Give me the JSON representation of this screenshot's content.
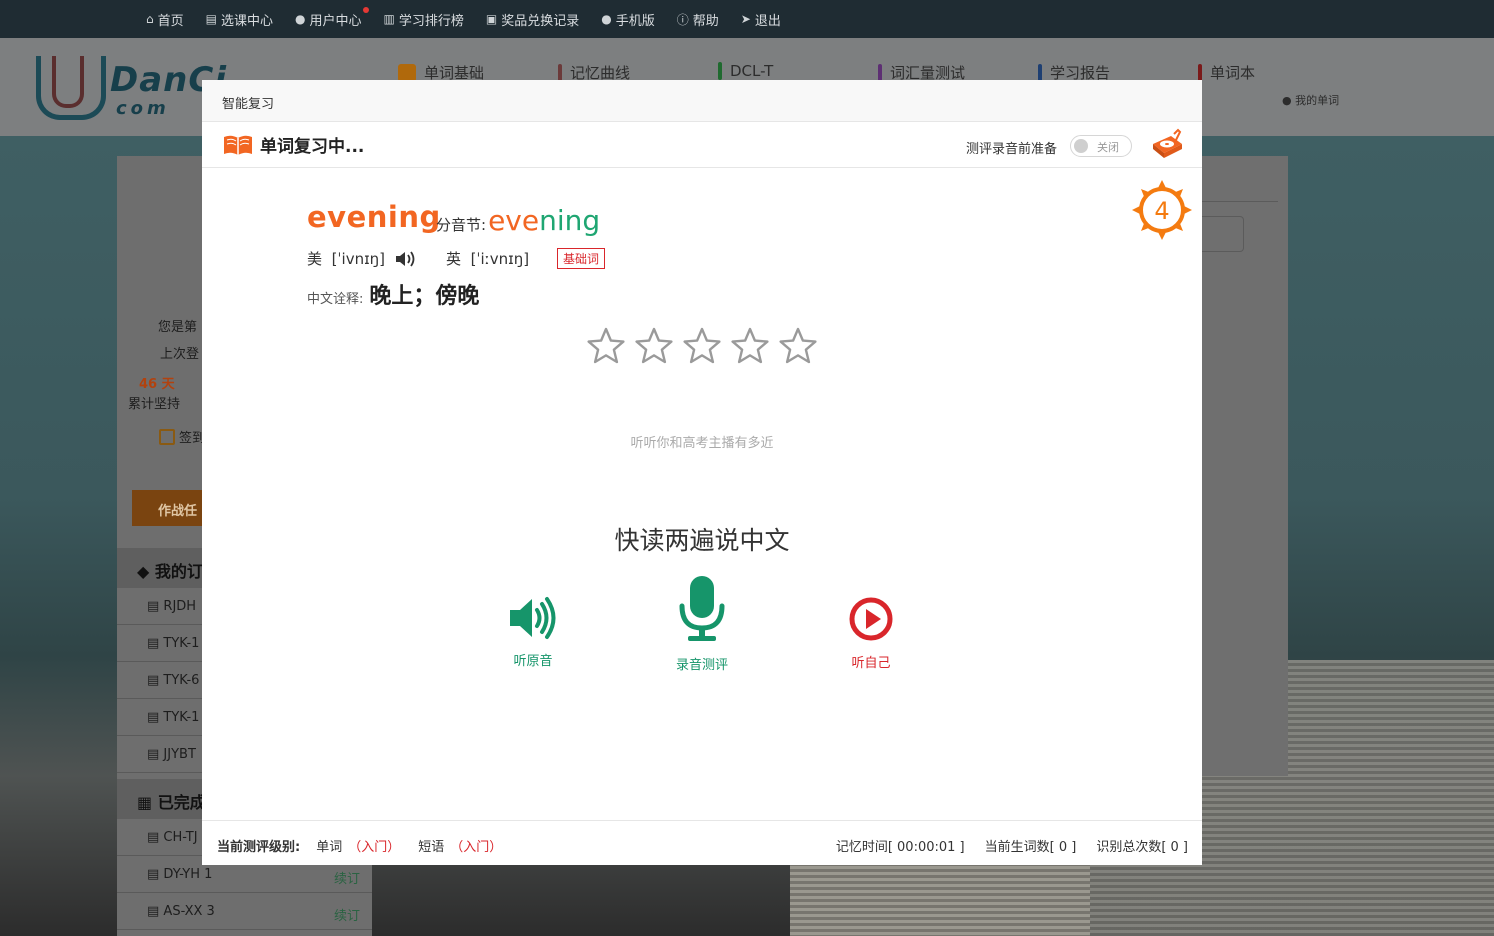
{
  "topnav": {
    "items": [
      {
        "label": "首页",
        "icon": "home-icon"
      },
      {
        "label": "选课中心",
        "icon": "book-icon"
      },
      {
        "label": "用户中心",
        "icon": "user-icon"
      },
      {
        "label": "学习排行榜",
        "icon": "bar-chart-icon"
      },
      {
        "label": "奖品兑换记录",
        "icon": "gift-icon"
      },
      {
        "label": "手机版",
        "icon": "apple-icon"
      },
      {
        "label": "帮助",
        "icon": "info-icon"
      },
      {
        "label": "退出",
        "icon": "send-icon"
      }
    ]
  },
  "logo": {
    "line1": "DanCi",
    "line2": "com"
  },
  "mainnav": {
    "items": [
      {
        "label": "单词基础",
        "color": "#b0690c"
      },
      {
        "label": "记忆曲线",
        "color": "#6b3a3a"
      },
      {
        "label": "DCL-T",
        "color": "#1f6a2f"
      },
      {
        "label": "词汇量测试",
        "color": "#5d2f73"
      },
      {
        "label": "学习报告",
        "color": "#1e3f72"
      },
      {
        "label": "单词本",
        "color": "#7a1a1a"
      }
    ],
    "sub": "我的单词"
  },
  "sidebar": {
    "rank_text": "您是第",
    "last_login": "上次登",
    "days": "46 天",
    "days_label": "累计坚持",
    "signin": "签到",
    "task_button": "作战任",
    "section_subscribed": "我的订",
    "subscribed": [
      "RJDH",
      "TYK-1",
      "TYK-6",
      "TYK-1",
      "JJYBT"
    ],
    "section_done": "已完成",
    "done": [
      {
        "name": "CH-TJ",
        "action": ""
      },
      {
        "name": "DY-YH 1",
        "action": "续订"
      },
      {
        "name": "AS-XX 3",
        "action": "续订"
      }
    ]
  },
  "modal": {
    "title": "智能复习",
    "toolbar": {
      "heading": "单词复习中...",
      "prep_label": "测评录音前准备",
      "switch_label": "关闭"
    },
    "badge": "4",
    "word": "evening",
    "syllable_label": "分音节:",
    "syllable_a": "eve",
    "syllable_b": "ning",
    "us_label": "美",
    "us_phonetic": "[ˈivnɪŋ]",
    "uk_label": "英",
    "uk_phonetic": "[ˈiːvnɪŋ]",
    "level_tag": "基础词",
    "cn_label": "中文诠释:",
    "cn_value": "晚上；傍晚",
    "rating": 0,
    "rating_max": 5,
    "hint": "听听你和高考主播有多近",
    "instruction": "快读两遍说中文",
    "actions": {
      "listen_original": "听原音",
      "record": "录音测评",
      "listen_self": "听自己"
    },
    "footer": {
      "level_label": "当前测评级别:",
      "word_label": "单词",
      "word_level": "（入门）",
      "phrase_label": "短语",
      "phrase_level": "（入门）",
      "memory_time": "记忆时间[ 00:00:01 ]",
      "new_words": "当前生词数[ 0 ]",
      "recognize_count": "识别总次数[ 0 ]"
    }
  },
  "colors": {
    "orange": "#f26622",
    "green": "#1fa672",
    "red": "#d9262b",
    "mic_green": "#16956a"
  }
}
